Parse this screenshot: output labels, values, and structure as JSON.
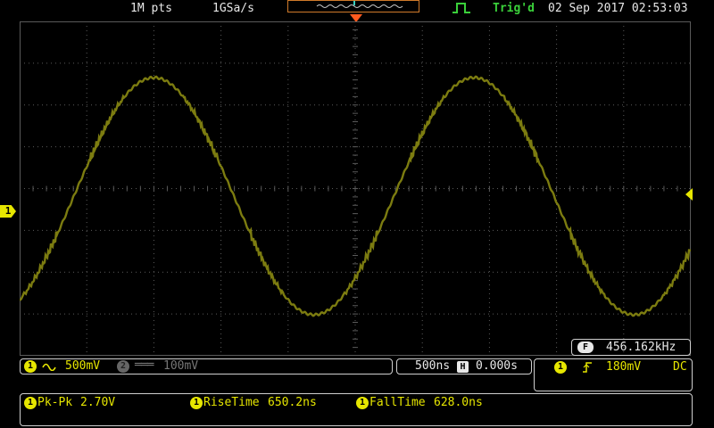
{
  "header": {
    "record_length": "1M pts",
    "sample_rate": "1GSa/s",
    "trigger_status": "Trig'd",
    "datetime": "02 Sep 2017 02:53:03"
  },
  "channel1": {
    "marker": "1",
    "scale": "500mV",
    "coupling_icon": "ac-wave-icon",
    "color": "#e6e600"
  },
  "channel2": {
    "marker": "2",
    "scale": "100mV"
  },
  "timebase": {
    "scale": "500ns",
    "h_icon": "H",
    "position": "0.000s"
  },
  "trigger": {
    "source": "1",
    "slope": "rising-edge-icon",
    "level": "180mV",
    "coupling": "DC"
  },
  "frequency": {
    "icon": "F",
    "value": "456.162kHz"
  },
  "measurements": [
    {
      "label": "Pk-Pk",
      "value": "2.70V"
    },
    {
      "label": "RiseTime",
      "value": "650.2ns"
    },
    {
      "label": "FallTime",
      "value": "628.0ns"
    }
  ],
  "colors": {
    "trace": "#7c7c10",
    "grid": "#5a5a5a",
    "trigger_marker": "#ff5a1e",
    "memory_bar": "#d07a2a"
  }
}
